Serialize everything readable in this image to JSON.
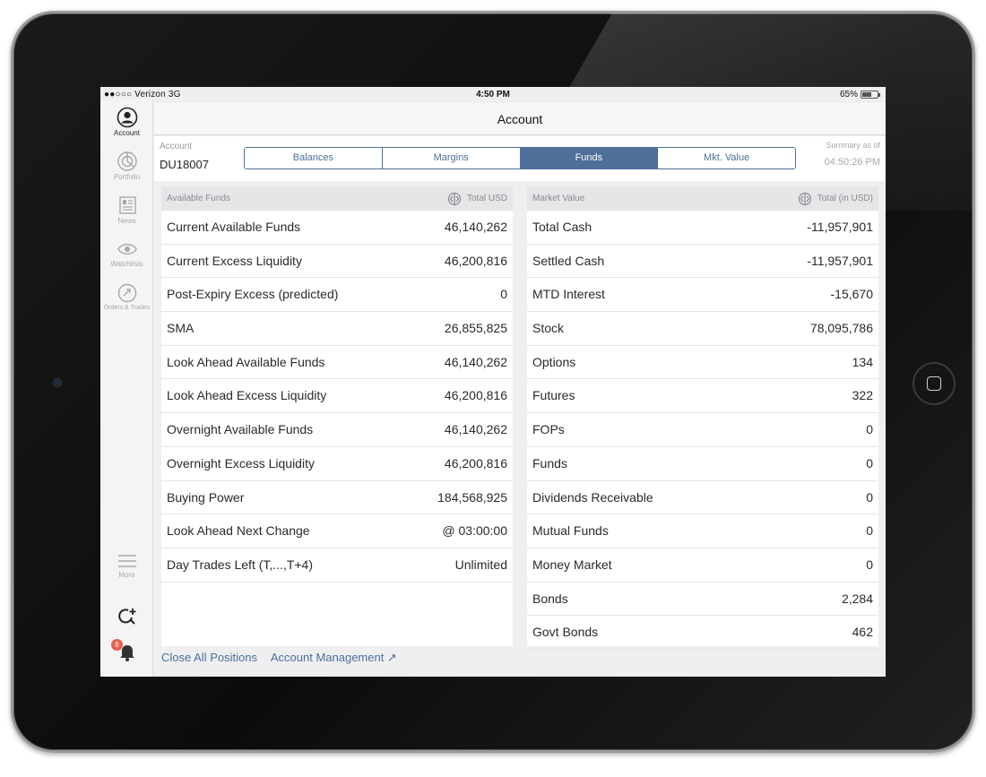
{
  "status_bar": {
    "carrier": "●●○○○ Verizon  3G",
    "time": "4:50 PM",
    "battery": "65%",
    "battery_level": 0.65
  },
  "sidebar": {
    "items": [
      {
        "label": "Account",
        "icon": "user-circle-icon"
      },
      {
        "label": "Portfolio",
        "icon": "pie-chart-icon"
      },
      {
        "label": "News",
        "icon": "news-icon"
      },
      {
        "label": "Watchlists",
        "icon": "eye-icon"
      },
      {
        "label": "Orders & Trades",
        "icon": "orders-icon"
      }
    ],
    "more_label": "More",
    "notification_count": "6"
  },
  "header": {
    "title": "Account"
  },
  "account": {
    "label": "Account",
    "id": "DU18007"
  },
  "tabs": [
    {
      "label": "Balances"
    },
    {
      "label": "Margins"
    },
    {
      "label": "Funds"
    },
    {
      "label": "Mkt. Value"
    }
  ],
  "summary": {
    "label": "Summary as of",
    "time": "04:50:26 PM"
  },
  "funds_panel": {
    "title": "Available Funds",
    "column": "Total USD",
    "rows": [
      {
        "label": "Current Available Funds",
        "value": "46,140,262"
      },
      {
        "label": "Current Excess Liquidity",
        "value": "46,200,816"
      },
      {
        "label": "Post-Expiry Excess (predicted)",
        "value": "0"
      },
      {
        "label": "SMA",
        "value": "26,855,825"
      },
      {
        "label": "Look Ahead Available Funds",
        "value": "46,140,262"
      },
      {
        "label": "Look Ahead Excess Liquidity",
        "value": "46,200,816"
      },
      {
        "label": "Overnight Available Funds",
        "value": "46,140,262"
      },
      {
        "label": "Overnight Excess Liquidity",
        "value": "46,200,816"
      },
      {
        "label": "Buying Power",
        "value": "184,568,925"
      },
      {
        "label": "Look Ahead Next Change",
        "value": "@ 03:00:00"
      },
      {
        "label": "Day Trades Left (T,...,T+4)",
        "value": "Unlimited"
      }
    ]
  },
  "market_panel": {
    "title": "Market Value",
    "column": "Total (in USD)",
    "rows": [
      {
        "label": "Total Cash",
        "value": "-11,957,901"
      },
      {
        "label": "Settled Cash",
        "value": "-11,957,901"
      },
      {
        "label": "MTD Interest",
        "value": "-15,670"
      },
      {
        "label": "Stock",
        "value": "78,095,786"
      },
      {
        "label": "Options",
        "value": "134"
      },
      {
        "label": "Futures",
        "value": "322"
      },
      {
        "label": "FOPs",
        "value": "0"
      },
      {
        "label": "Funds",
        "value": "0"
      },
      {
        "label": "Dividends Receivable",
        "value": "0"
      },
      {
        "label": "Mutual Funds",
        "value": "0"
      },
      {
        "label": "Money Market",
        "value": "0"
      },
      {
        "label": "Bonds",
        "value": "2,284"
      },
      {
        "label": "Govt Bonds",
        "value": "462"
      }
    ]
  },
  "footer": {
    "close_positions": "Close All Positions",
    "account_management": "Account Management ↗"
  },
  "colors": {
    "accent": "#4e6f9a",
    "badge": "#e8604c"
  }
}
